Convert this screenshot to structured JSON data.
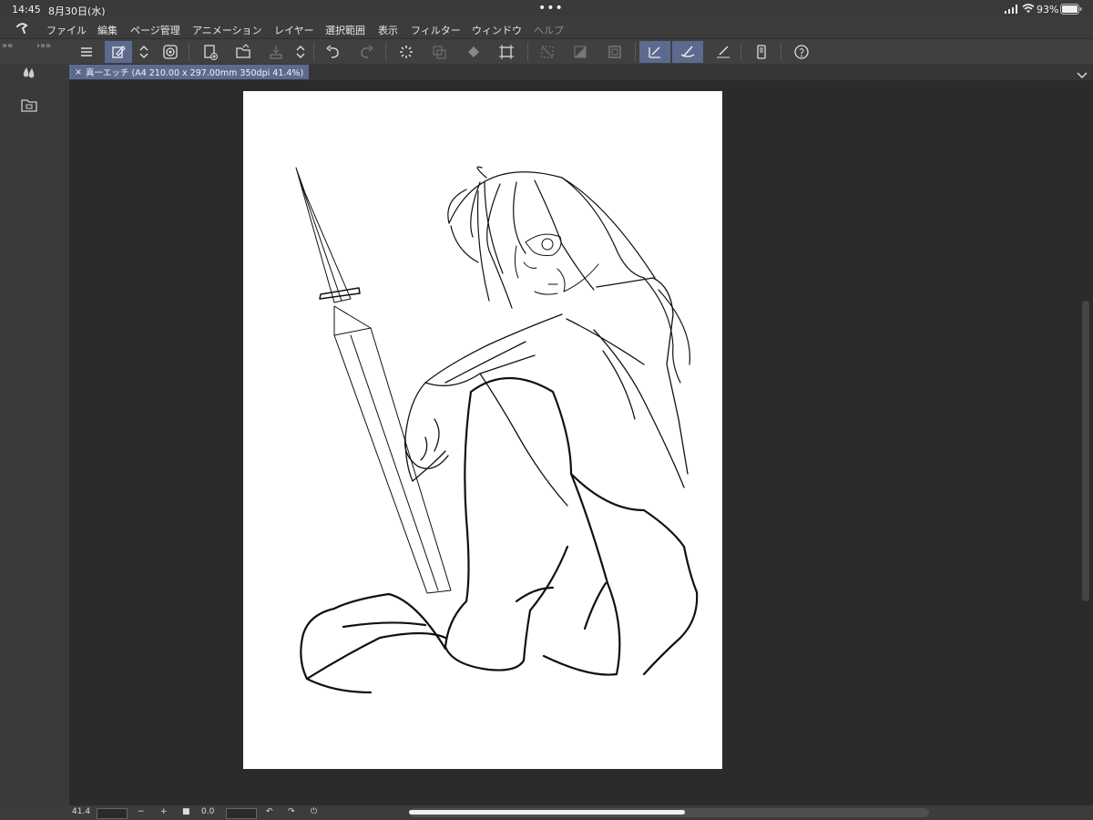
{
  "status_bar": {
    "time": "14:45",
    "date": "8月30日(水)",
    "battery": "93%"
  },
  "menu": {
    "items": [
      "ファイル",
      "編集",
      "ページ管理",
      "アニメーション",
      "レイヤー",
      "選択範囲",
      "表示",
      "フィルター",
      "ウィンドウ",
      "ヘルプ"
    ]
  },
  "document": {
    "tab_label": "真一エッチ (A4 210.00 x 297.00mm 350dpi 41.4%)",
    "close_symbol": "×"
  },
  "bottom_bar": {
    "zoom_value": "41.4",
    "rotation_value": "0.0",
    "minus": "−",
    "plus": "+"
  },
  "colors": {
    "accent": "#5d6a8f",
    "background": "#2b2b2b",
    "panel": "#3c3c3c"
  },
  "toolbar": {
    "icons": [
      "menu-icon",
      "edit-page-icon",
      "updown-icon",
      "spiral-icon",
      "new-page-icon",
      "open-folder-icon",
      "save-icon",
      "updown-icon",
      "undo-icon",
      "redo-icon",
      "loading-icon",
      "transform-icon",
      "fill-icon",
      "crop-icon",
      "deselect-icon",
      "invert-icon",
      "frame-icon",
      "ruler-pen-icon",
      "brush-icon",
      "pen-icon",
      "device-icon",
      "help-icon"
    ]
  }
}
